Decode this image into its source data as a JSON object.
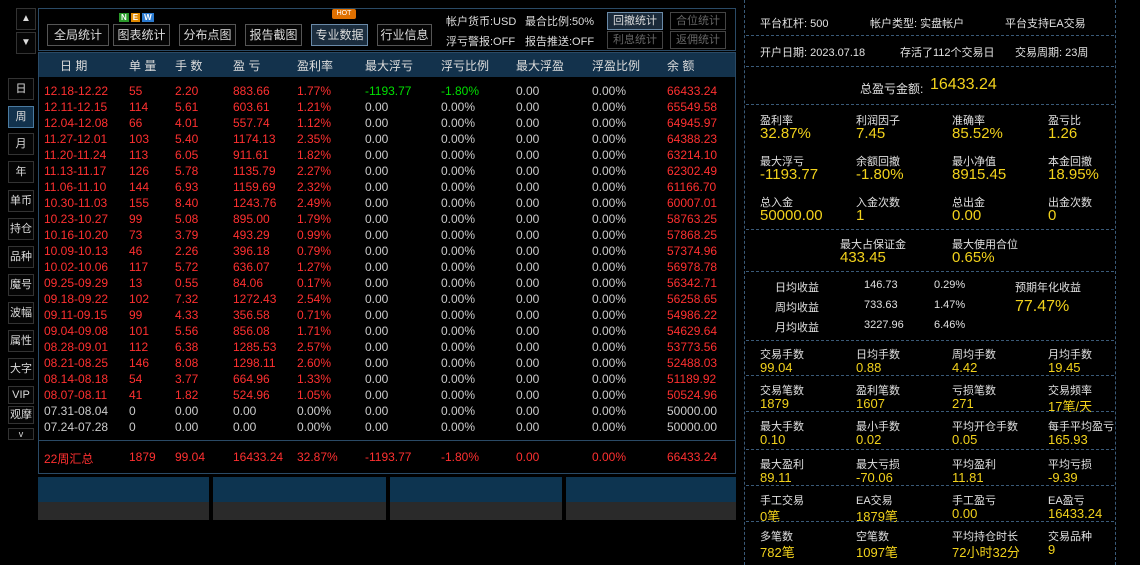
{
  "side_menu": {
    "up": "▲",
    "down": "▼",
    "more": "v",
    "items": [
      "日",
      "周",
      "月",
      "年",
      "单币",
      "持仓",
      "品种",
      "魔号",
      "波幅",
      "属性",
      "大字",
      "VIP",
      "观摩"
    ]
  },
  "toolbar": {
    "buttons": [
      "全局统计",
      "图表统计",
      "分布点图",
      "报告截图",
      "专业数据",
      "行业信息"
    ],
    "badge_new": [
      "N",
      "E",
      "W"
    ],
    "badge_hot": "HOT",
    "currency": "帐户货币:USD",
    "max_ratio": "最合比例:50%",
    "float_alert": "浮亏警报:OFF",
    "report_push": "报告推送:OFF",
    "small_buttons": [
      "回撤统计",
      "合位统计",
      "利息统计",
      "返佣统计"
    ]
  },
  "table": {
    "headers": [
      "日 期",
      "单 量",
      "手 数",
      "盈 亏",
      "盈利率",
      "最大浮亏",
      "浮亏比例",
      "最大浮盈",
      "浮盈比例",
      "余 额"
    ],
    "rows": [
      [
        "12.18-12.22",
        "55",
        "2.20",
        "883.66",
        "1.77%",
        "-1193.77",
        "-1.80%",
        "0.00",
        "0.00%",
        "66433.24"
      ],
      [
        "12.11-12.15",
        "114",
        "5.61",
        "603.61",
        "1.21%",
        "0.00",
        "0.00%",
        "0.00",
        "0.00%",
        "65549.58"
      ],
      [
        "12.04-12.08",
        "66",
        "4.01",
        "557.74",
        "1.12%",
        "0.00",
        "0.00%",
        "0.00",
        "0.00%",
        "64945.97"
      ],
      [
        "11.27-12.01",
        "103",
        "5.40",
        "1174.13",
        "2.35%",
        "0.00",
        "0.00%",
        "0.00",
        "0.00%",
        "64388.23"
      ],
      [
        "11.20-11.24",
        "113",
        "6.05",
        "911.61",
        "1.82%",
        "0.00",
        "0.00%",
        "0.00",
        "0.00%",
        "63214.10"
      ],
      [
        "11.13-11.17",
        "126",
        "5.78",
        "1135.79",
        "2.27%",
        "0.00",
        "0.00%",
        "0.00",
        "0.00%",
        "62302.49"
      ],
      [
        "11.06-11.10",
        "144",
        "6.93",
        "1159.69",
        "2.32%",
        "0.00",
        "0.00%",
        "0.00",
        "0.00%",
        "61166.70"
      ],
      [
        "10.30-11.03",
        "155",
        "8.40",
        "1243.76",
        "2.49%",
        "0.00",
        "0.00%",
        "0.00",
        "0.00%",
        "60007.01"
      ],
      [
        "10.23-10.27",
        "99",
        "5.08",
        "895.00",
        "1.79%",
        "0.00",
        "0.00%",
        "0.00",
        "0.00%",
        "58763.25"
      ],
      [
        "10.16-10.20",
        "73",
        "3.79",
        "493.29",
        "0.99%",
        "0.00",
        "0.00%",
        "0.00",
        "0.00%",
        "57868.25"
      ],
      [
        "10.09-10.13",
        "46",
        "2.26",
        "396.18",
        "0.79%",
        "0.00",
        "0.00%",
        "0.00",
        "0.00%",
        "57374.96"
      ],
      [
        "10.02-10.06",
        "117",
        "5.72",
        "636.07",
        "1.27%",
        "0.00",
        "0.00%",
        "0.00",
        "0.00%",
        "56978.78"
      ],
      [
        "09.25-09.29",
        "13",
        "0.55",
        "84.06",
        "0.17%",
        "0.00",
        "0.00%",
        "0.00",
        "0.00%",
        "56342.71"
      ],
      [
        "09.18-09.22",
        "102",
        "7.32",
        "1272.43",
        "2.54%",
        "0.00",
        "0.00%",
        "0.00",
        "0.00%",
        "56258.65"
      ],
      [
        "09.11-09.15",
        "99",
        "4.33",
        "356.58",
        "0.71%",
        "0.00",
        "0.00%",
        "0.00",
        "0.00%",
        "54986.22"
      ],
      [
        "09.04-09.08",
        "101",
        "5.56",
        "856.08",
        "1.71%",
        "0.00",
        "0.00%",
        "0.00",
        "0.00%",
        "54629.64"
      ],
      [
        "08.28-09.01",
        "112",
        "6.38",
        "1285.53",
        "2.57%",
        "0.00",
        "0.00%",
        "0.00",
        "0.00%",
        "53773.56"
      ],
      [
        "08.21-08.25",
        "146",
        "8.08",
        "1298.11",
        "2.60%",
        "0.00",
        "0.00%",
        "0.00",
        "0.00%",
        "52488.03"
      ],
      [
        "08.14-08.18",
        "54",
        "3.77",
        "664.96",
        "1.33%",
        "0.00",
        "0.00%",
        "0.00",
        "0.00%",
        "51189.92"
      ],
      [
        "08.07-08.11",
        "41",
        "1.82",
        "524.96",
        "1.05%",
        "0.00",
        "0.00%",
        "0.00",
        "0.00%",
        "50524.96"
      ],
      [
        "07.31-08.04",
        "0",
        "0.00",
        "0.00",
        "0.00%",
        "0.00",
        "0.00%",
        "0.00",
        "0.00%",
        "50000.00"
      ],
      [
        "07.24-07.28",
        "0",
        "0.00",
        "0.00",
        "0.00%",
        "0.00",
        "0.00%",
        "0.00",
        "0.00%",
        "50000.00"
      ]
    ],
    "summary": [
      "22周汇总",
      "1879",
      "99.04",
      "16433.24",
      "32.87%",
      "-1193.77",
      "-1.80%",
      "0.00",
      "0.00%",
      "66433.24"
    ]
  },
  "right": {
    "top_row": [
      "平台杠杆:  500",
      "帐户类型:  实盘帐户",
      "平台支持EA交易"
    ],
    "second_row": [
      "开户日期:  2023.07.18",
      "存活了112个交易日",
      "交易周期:  23周"
    ],
    "total_label": "总盈亏金额:",
    "total_value": "16433.24",
    "grid1": [
      {
        "l": "盈利率",
        "v": "32.87%"
      },
      {
        "l": "利润因子",
        "v": "7.45"
      },
      {
        "l": "准确率",
        "v": "85.52%"
      },
      {
        "l": "盈亏比",
        "v": "1.26"
      },
      {
        "l": "最大浮亏",
        "v": "-1193.77"
      },
      {
        "l": "余额回撤",
        "v": "-1.80%"
      },
      {
        "l": "最小净值",
        "v": "8915.45"
      },
      {
        "l": "本金回撤",
        "v": "18.95%"
      },
      {
        "l": "总入金",
        "v": "50000.00"
      },
      {
        "l": "入金次数",
        "v": "1"
      },
      {
        "l": "总出金",
        "v": "0.00"
      },
      {
        "l": "出金次数",
        "v": "0"
      }
    ],
    "margin": [
      {
        "l": "最大占保证金",
        "v": "433.45"
      },
      {
        "l": "最大使用合位",
        "v": "0.65%"
      }
    ],
    "income": [
      [
        "日均收益",
        "146.73",
        "0.29%"
      ],
      [
        "周均收益",
        "733.63",
        "1.47%"
      ],
      [
        "月均收益",
        "3227.96",
        "6.46%"
      ]
    ],
    "annual_label": "预期年化收益",
    "annual_value": "77.47%",
    "grid2": [
      {
        "l": "交易手数",
        "v": "99.04"
      },
      {
        "l": "日均手数",
        "v": "0.88"
      },
      {
        "l": "周均手数",
        "v": "4.42"
      },
      {
        "l": "月均手数",
        "v": "19.45"
      },
      {
        "l": "交易笔数",
        "v": "1879"
      },
      {
        "l": "盈利笔数",
        "v": "1607"
      },
      {
        "l": "亏损笔数",
        "v": "271"
      },
      {
        "l": "交易频率",
        "v": "17笔/天"
      },
      {
        "l": "最大手数",
        "v": "0.10"
      },
      {
        "l": "最小手数",
        "v": "0.02"
      },
      {
        "l": "平均开仓手数",
        "v": "0.05"
      },
      {
        "l": "每手平均盈亏",
        "v": "165.93"
      },
      {
        "l": "最大盈利",
        "v": "89.11"
      },
      {
        "l": "最大亏损",
        "v": "-70.06"
      },
      {
        "l": "平均盈利",
        "v": "11.81"
      },
      {
        "l": "平均亏损",
        "v": "-9.39"
      },
      {
        "l": "手工交易",
        "v": "0笔"
      },
      {
        "l": "EA交易",
        "v": "1879笔"
      },
      {
        "l": "手工盈亏",
        "v": "0.00"
      },
      {
        "l": "EA盈亏",
        "v": "16433.24"
      },
      {
        "l": "多笔数",
        "v": "782笔"
      },
      {
        "l": "空笔数",
        "v": "1097笔"
      },
      {
        "l": "平均持仓时长",
        "v": "72小时32分"
      },
      {
        "l": "交易品种",
        "v": "9"
      }
    ]
  }
}
